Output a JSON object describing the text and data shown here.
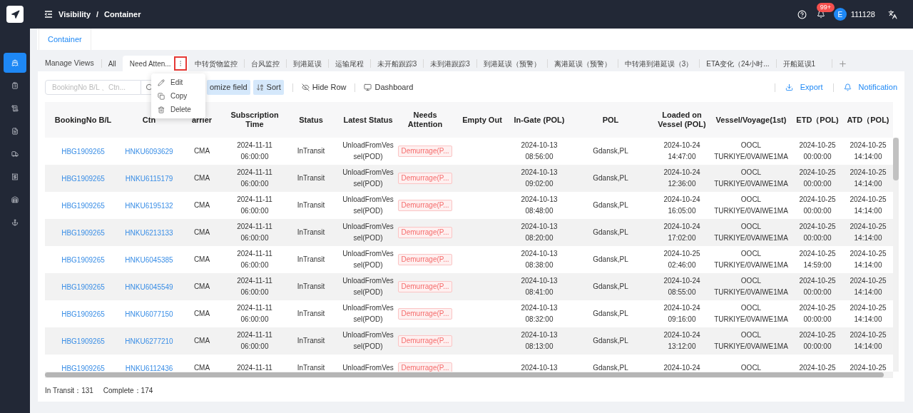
{
  "header": {
    "breadcrumb": [
      "Visibility",
      "Container"
    ],
    "separator": "/",
    "notifications": "99+",
    "avatar": "E",
    "user": "111128"
  },
  "sidebar": {
    "items": [
      {
        "selected": true
      },
      {
        "selected": false
      },
      {
        "selected": false
      },
      {
        "selected": false
      },
      {
        "selected": false
      },
      {
        "selected": false
      },
      {
        "selected": false
      },
      {
        "selected": false
      }
    ]
  },
  "page_tabs": [
    {
      "label": "Container",
      "selected": true
    }
  ],
  "manage_views": "Manage Views",
  "views": [
    {
      "label": "All",
      "selected": false
    },
    {
      "label": "Need Atten...",
      "selected": true
    },
    {
      "label": "中转货物监控",
      "selected": false
    },
    {
      "label": "台风监控",
      "selected": false
    },
    {
      "label": "到港延误",
      "selected": false
    },
    {
      "label": "运输尾程",
      "selected": false
    },
    {
      "label": "未开船跟踪3",
      "selected": false
    },
    {
      "label": "未到港跟踪3",
      "selected": false
    },
    {
      "label": "到港延误（预警）",
      "selected": false
    },
    {
      "label": "离港延误（预警）",
      "selected": false
    },
    {
      "label": "中转港到港延误（3）",
      "selected": false
    },
    {
      "label": "ETA变化（24小时...",
      "selected": false
    },
    {
      "label": "开船延误1",
      "selected": false
    }
  ],
  "view_menu": [
    {
      "label": "Edit",
      "kind": "edit"
    },
    {
      "label": "Copy",
      "kind": "copy"
    },
    {
      "label": "Delete",
      "kind": "delete"
    }
  ],
  "search": {
    "placeholder": "BookingNo B/L 、Ctn..."
  },
  "toolbar": [
    {
      "label": "omize field",
      "kind": "customize"
    },
    {
      "label": "Sort",
      "kind": "sort"
    },
    {
      "label": "Hide Row",
      "kind": "hide"
    },
    {
      "label": "Dashboard",
      "kind": "dashboard"
    }
  ],
  "actions": [
    {
      "label": "Export",
      "kind": "export"
    },
    {
      "label": "Notification",
      "kind": "notify"
    }
  ],
  "table": {
    "columns": [
      {
        "label": "BookingNo B/L",
        "kind": "link"
      },
      {
        "label": "Ctn",
        "kind": "link"
      },
      {
        "label": "arrier",
        "kind": "text"
      },
      {
        "label": "Subscription Time",
        "kind": "text"
      },
      {
        "label": "Status",
        "kind": "text"
      },
      {
        "label": "Latest Status",
        "kind": "wrap"
      },
      {
        "label": "Needs Attention",
        "kind": "tag"
      },
      {
        "label": "Empty Out"
      },
      {
        "label": "In-Gate (POL)",
        "kind": "text"
      },
      {
        "label": "POL",
        "kind": "text"
      },
      {
        "label": "Loaded on Vessel (POL)",
        "kind": "text"
      },
      {
        "label": "Vessel/Voyage(1st)",
        "kind": "text"
      },
      {
        "label": "ETD（POL)",
        "kind": "text"
      },
      {
        "label": "ATD（POL)",
        "kind": "text"
      }
    ],
    "rows": [
      {
        "cells": [
          "HBG1909265",
          "HNKU6093629",
          "CMA",
          "2024-11-11 06:00:00",
          "InTransit",
          "UnloadFromVessel(POD)",
          "Demurrage(P...",
          "",
          "2024-10-13 08:56:00",
          "Gdansk,PL",
          "2024-10-24 14:47:00",
          "OOCL TURKIYE/0VAIWE1MA",
          "2024-10-25 00:00:00",
          "2024-10-25 14:14:00"
        ]
      },
      {
        "cells": [
          "HBG1909265",
          "HNKU6115179",
          "CMA",
          "2024-11-11 06:00:00",
          "InTransit",
          "UnloadFromVessel(POD)",
          "Demurrage(P...",
          "",
          "2024-10-13 09:02:00",
          "Gdansk,PL",
          "2024-10-24 12:36:00",
          "OOCL TURKIYE/0VAIWE1MA",
          "2024-10-25 00:00:00",
          "2024-10-25 14:14:00"
        ]
      },
      {
        "cells": [
          "HBG1909265",
          "HNKU6195132",
          "CMA",
          "2024-11-11 06:00:00",
          "InTransit",
          "UnloadFromVessel(POD)",
          "Demurrage(P...",
          "",
          "2024-10-13 08:48:00",
          "Gdansk,PL",
          "2024-10-24 16:05:00",
          "OOCL TURKIYE/0VAIWE1MA",
          "2024-10-25 00:00:00",
          "2024-10-25 14:14:00"
        ]
      },
      {
        "cells": [
          "HBG1909265",
          "HNKU6213133",
          "CMA",
          "2024-11-11 06:00:00",
          "InTransit",
          "UnloadFromVessel(POD)",
          "Demurrage(P...",
          "",
          "2024-10-13 08:20:00",
          "Gdansk,PL",
          "2024-10-24 17:02:00",
          "OOCL TURKIYE/0VAIWE1MA",
          "2024-10-25 00:00:00",
          "2024-10-25 14:14:00"
        ]
      },
      {
        "cells": [
          "HBG1909265",
          "HNKU6045385",
          "CMA",
          "2024-11-11 06:00:00",
          "InTransit",
          "UnloadFromVessel(POD)",
          "Demurrage(P...",
          "",
          "2024-10-13 08:38:00",
          "Gdansk,PL",
          "2024-10-25 02:46:00",
          "OOCL TURKIYE/0VAIWE1MA",
          "2024-10-25 14:59:00",
          "2024-10-25 14:14:00"
        ]
      },
      {
        "cells": [
          "HBG1909265",
          "HNKU6045549",
          "CMA",
          "2024-11-11 06:00:00",
          "InTransit",
          "UnloadFromVessel(POD)",
          "Demurrage(P...",
          "",
          "2024-10-13 08:41:00",
          "Gdansk,PL",
          "2024-10-24 08:55:00",
          "OOCL TURKIYE/0VAIWE1MA",
          "2024-10-25 00:00:00",
          "2024-10-25 14:14:00"
        ]
      },
      {
        "cells": [
          "HBG1909265",
          "HNKU6077150",
          "CMA",
          "2024-11-11 06:00:00",
          "InTransit",
          "UnloadFromVessel(POD)",
          "Demurrage(P...",
          "",
          "2024-10-13 08:32:00",
          "Gdansk,PL",
          "2024-10-24 09:16:00",
          "OOCL TURKIYE/0VAIWE1MA",
          "2024-10-25 00:00:00",
          "2024-10-25 14:14:00"
        ]
      },
      {
        "cells": [
          "HBG1909265",
          "HNKU6277210",
          "CMA",
          "2024-11-11 06:00:00",
          "InTransit",
          "UnloadFromVessel(POD)",
          "Demurrage(P...",
          "",
          "2024-10-13 08:13:00",
          "Gdansk,PL",
          "2024-10-24 13:12:00",
          "OOCL TURKIYE/0VAIWE1MA",
          "2024-10-25 00:00:00",
          "2024-10-25 14:14:00"
        ]
      },
      {
        "cells": [
          "HBG1909265",
          "HNKU6112436",
          "CMA",
          "2024-11-11",
          "InTransit",
          "UnloadFromVes",
          "Demurrage(P...",
          "",
          "2024-10-13",
          "Gdansk,PL",
          "2024-10-24",
          "OOCL",
          "2024-10-25",
          "2024-10-25"
        ]
      }
    ]
  },
  "footer": [
    "In Transit：131",
    "Complete：174"
  ]
}
